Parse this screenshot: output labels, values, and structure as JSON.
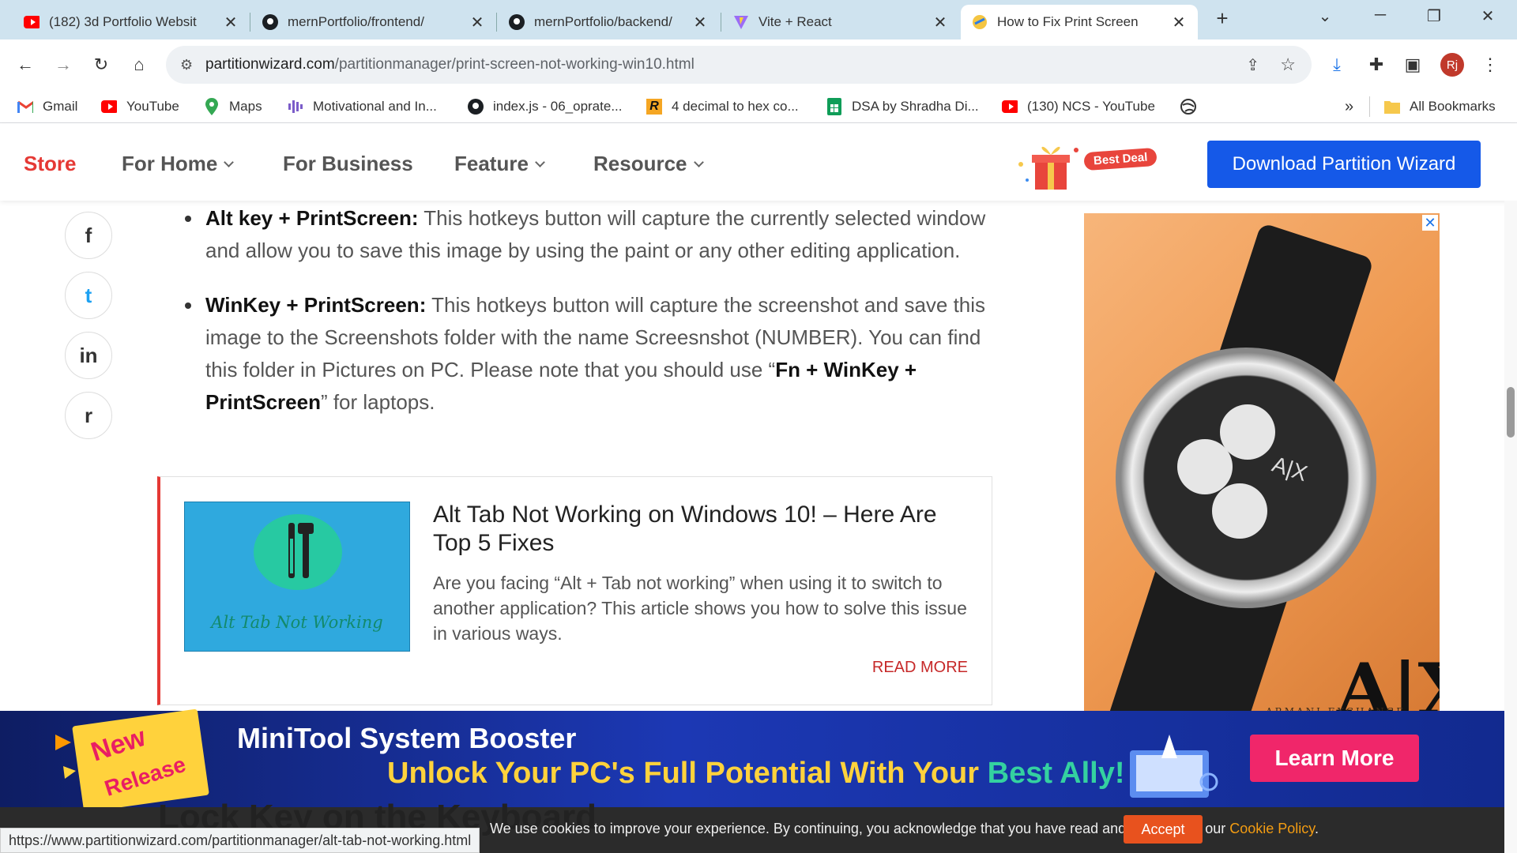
{
  "browser": {
    "tabs": [
      {
        "title": "(182) 3d Portfolio Websit",
        "icon": "youtube-icon",
        "active": false
      },
      {
        "title": "mernPortfolio/frontend/",
        "icon": "github-icon",
        "active": false
      },
      {
        "title": "mernPortfolio/backend/",
        "icon": "github-icon",
        "active": false
      },
      {
        "title": "Vite + React",
        "icon": "vite-icon",
        "active": false
      },
      {
        "title": "How to Fix Print Screen",
        "icon": "partitionwizard-icon",
        "active": true
      }
    ],
    "new_tab": "+",
    "url_host": "partitionwizard.com",
    "url_path": "/partitionmanager/print-screen-not-working-win10.html",
    "profile_initials": "Rj",
    "bookmarks": [
      {
        "label": "Gmail",
        "icon": "gmail-icon"
      },
      {
        "label": "YouTube",
        "icon": "youtube-icon"
      },
      {
        "label": "Maps",
        "icon": "maps-icon"
      },
      {
        "label": "Motivational and In...",
        "icon": "podcast-icon"
      },
      {
        "label": "index.js - 06_oprate...",
        "icon": "github-icon"
      },
      {
        "label": "4 decimal to hex co...",
        "icon": "r-icon"
      },
      {
        "label": "DSA by Shradha Di...",
        "icon": "sheets-icon"
      },
      {
        "label": "(130) NCS - YouTube",
        "icon": "youtube-icon"
      }
    ],
    "bookmarks_overflow": "»",
    "all_bookmarks": "All Bookmarks"
  },
  "site_nav": {
    "store": "Store",
    "for_home": "For Home",
    "for_business": "For Business",
    "feature": "Feature",
    "resource": "Resource",
    "best_deal": "Best Deal",
    "download_button": "Download Partition Wizard"
  },
  "share": [
    "f",
    "t",
    "in",
    "r"
  ],
  "article": {
    "bullet1_bold": "Alt key + PrintScreen:",
    "bullet1_text": " This hotkeys button will capture the currently selected window and allow you to save this image by using the paint or any other editing application.",
    "bullet2_bold": "WinKey + PrintScreen:",
    "bullet2_text": "  This hotkeys button will capture the screenshot and save this image to the Screenshots folder with the name Screesnshot (NUMBER). You can find this folder in Pictures on PC. Please note that you should use “",
    "bullet2_bold2": "Fn + WinKey + PrintScreen",
    "bullet2_end": "” for laptops."
  },
  "related_card": {
    "image_caption": "Alt Tab Not Working",
    "title": "Alt Tab Not Working on Windows 10! – Here Are Top 5 Fixes",
    "description": "Are you facing “Alt + Tab not working” when using it to switch to another application? This article shows you how to solve this issue in various ways.",
    "read_more": "READ MORE"
  },
  "ad_watch": {
    "close": "✕",
    "dial_brand": "A|X",
    "footer_brand": "ARMANI EXCHANGE"
  },
  "bottom_banner": {
    "badge_line1": "New",
    "badge_line2": "Release",
    "title": "MiniTool System Booster",
    "subtitle_part1": "Unlock Your PC's Full Potential With Your ",
    "subtitle_part2": "Best Ally!",
    "button": "Learn More"
  },
  "cookie": {
    "obscured_heading": "Lock Key on the Keyboard",
    "text": "We use cookies to improve your experience. By continuing, you acknowledge that you have read and understand our ",
    "link": "Cookie Policy",
    "text_end": ".",
    "accept": "Accept"
  },
  "status_url": "https://www.partitionwizard.com/partitionmanager/alt-tab-not-working.html"
}
